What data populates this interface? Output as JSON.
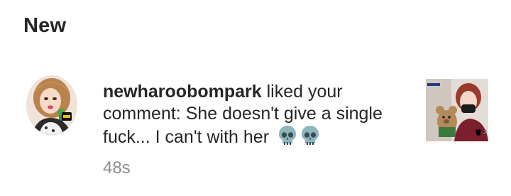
{
  "header": {
    "section_title": "New"
  },
  "notification": {
    "username": "newharoobompark",
    "message_text": " liked your comment: She doesn't give a single fuck... I can't with her",
    "emoji": [
      "skull-emoji",
      "skull-emoji"
    ],
    "timestamp": "48s",
    "thumbnail_caption": "팔 2"
  },
  "colors": {
    "primary_text": "#262626",
    "secondary_text": "#8e8e8e",
    "background": "#ffffff",
    "emoji_teal": "#8fb5bd"
  }
}
